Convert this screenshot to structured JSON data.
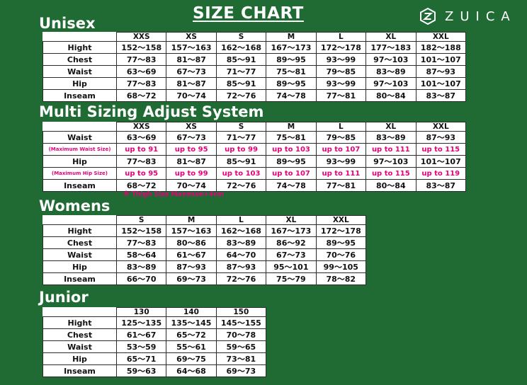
{
  "title": "SIZE CHART",
  "brand": "ZUICA",
  "unisex": {
    "heading": "Unisex",
    "columns": [
      "XXS",
      "XS",
      "S",
      "M",
      "L",
      "XL",
      "XXL"
    ],
    "rows": [
      {
        "label": "Hight",
        "values": [
          "152～158",
          "157～163",
          "162～168",
          "167～173",
          "172～178",
          "177～183",
          "182～188"
        ]
      },
      {
        "label": "Chest",
        "values": [
          "77～83",
          "81～87",
          "85～91",
          "89～95",
          "93～99",
          "97～103",
          "101～107"
        ]
      },
      {
        "label": "Waist",
        "values": [
          "63～69",
          "67～73",
          "71～77",
          "75～81",
          "79～85",
          "83～89",
          "87～93"
        ]
      },
      {
        "label": "Hip",
        "values": [
          "77～83",
          "81～87",
          "85～91",
          "89～95",
          "93～99",
          "97～103",
          "101～107"
        ]
      },
      {
        "label": "Inseam",
        "values": [
          "68～72",
          "70～74",
          "72～76",
          "74～78",
          "77～81",
          "80～84",
          "83～87"
        ]
      }
    ]
  },
  "multi": {
    "heading": "Multi Sizing Adjust System",
    "columns": [
      "XXS",
      "XS",
      "S",
      "M",
      "L",
      "XL",
      "XXL"
    ],
    "rows": [
      {
        "label": "Waist",
        "adj": false,
        "values": [
          "63～69",
          "67～73",
          "71～77",
          "75～81",
          "79～85",
          "83～89",
          "87～93"
        ]
      },
      {
        "label": "(Maximum Waist Size)",
        "adj": true,
        "values": [
          "up to 91",
          "up to 95",
          "up to 99",
          "up to 103",
          "up to 107",
          "up to 111",
          "up to 115"
        ]
      },
      {
        "label": "Hip",
        "adj": false,
        "values": [
          "77～83",
          "81～87",
          "85～91",
          "89～95",
          "93～99",
          "97～103",
          "101～107"
        ]
      },
      {
        "label": "(Maximum Hip Size)",
        "adj": true,
        "values": [
          "up to 95",
          "up to 99",
          "up to 103",
          "up to 107",
          "up to 111",
          "up to 115",
          "up to 119"
        ]
      },
      {
        "label": "Inseam",
        "adj": false,
        "values": [
          "68～72",
          "70～74",
          "72～76",
          "74～78",
          "77～81",
          "80～84",
          "83～87"
        ]
      }
    ],
    "note": "※ Thigh Size Maxmum+4cm"
  },
  "womens": {
    "heading": "Womens",
    "columns": [
      "S",
      "M",
      "L",
      "XL",
      "XXL"
    ],
    "rows": [
      {
        "label": "Hight",
        "values": [
          "152～158",
          "157～163",
          "162～168",
          "167～173",
          "172～178"
        ]
      },
      {
        "label": "Chest",
        "values": [
          "77～83",
          "80～86",
          "83～89",
          "86～92",
          "89～95"
        ]
      },
      {
        "label": "Waist",
        "values": [
          "58～64",
          "61～67",
          "64～70",
          "67～73",
          "70～76"
        ]
      },
      {
        "label": "Hip",
        "values": [
          "83～89",
          "87～93",
          "87～93",
          "95～101",
          "99～105"
        ]
      },
      {
        "label": "Inseam",
        "values": [
          "66～70",
          "69～73",
          "72～76",
          "75～79",
          "78～82"
        ]
      }
    ]
  },
  "junior": {
    "heading": "Junior",
    "columns": [
      "130",
      "140",
      "150"
    ],
    "rows": [
      {
        "label": "Hight",
        "values": [
          "125～135",
          "135～145",
          "145～155"
        ]
      },
      {
        "label": "Chest",
        "values": [
          "61～67",
          "65～72",
          "70～78"
        ]
      },
      {
        "label": "Waist",
        "values": [
          "53～59",
          "55～61",
          "59～65"
        ]
      },
      {
        "label": "Hip",
        "values": [
          "65～71",
          "69～75",
          "73～81"
        ]
      },
      {
        "label": "Inseam",
        "values": [
          "59～63",
          "64～68",
          "69～73"
        ]
      }
    ]
  }
}
